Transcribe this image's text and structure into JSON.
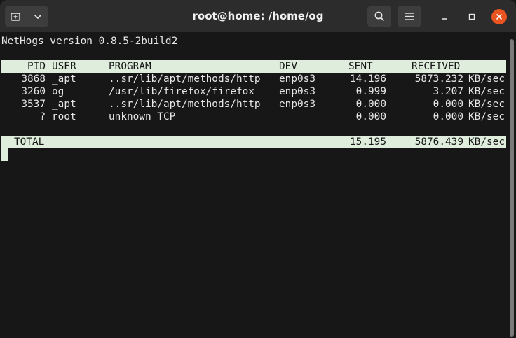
{
  "window": {
    "title": "root@home: /home/og",
    "new_tab_icon": "new-tab-icon",
    "menu_chevron_icon": "chevron-down-icon",
    "search_icon": "search-icon",
    "hamburger_icon": "hamburger-menu-icon",
    "close_color": "#e95420"
  },
  "terminal": {
    "version_line": "NetHogs version 0.8.5-2build2",
    "header": {
      "pid": "PID",
      "user": "USER",
      "program": "PROGRAM",
      "dev": "DEV",
      "sent": "SENT",
      "received": "RECEIVED"
    },
    "rows": [
      {
        "pid": "3868",
        "user": "_apt",
        "program": "..sr/lib/apt/methods/http",
        "dev": "enp0s3",
        "sent": "14.196",
        "received": "5873.232",
        "unit": "KB/sec"
      },
      {
        "pid": "3260",
        "user": "og",
        "program": "/usr/lib/firefox/firefox",
        "dev": "enp0s3",
        "sent": "0.999",
        "received": "3.207",
        "unit": "KB/sec"
      },
      {
        "pid": "3537",
        "user": "_apt",
        "program": "..sr/lib/apt/methods/http",
        "dev": "enp0s3",
        "sent": "0.000",
        "received": "0.000",
        "unit": "KB/sec"
      },
      {
        "pid": "?",
        "user": "root",
        "program": "unknown TCP",
        "dev": "",
        "sent": "0.000",
        "received": "0.000",
        "unit": "KB/sec"
      }
    ],
    "total": {
      "label": "TOTAL",
      "sent": "15.195",
      "received": "5876.439",
      "unit": "KB/sec"
    },
    "colors": {
      "background": "#171717",
      "foreground": "#e6e6e6",
      "highlight": "#dfeedc"
    }
  }
}
